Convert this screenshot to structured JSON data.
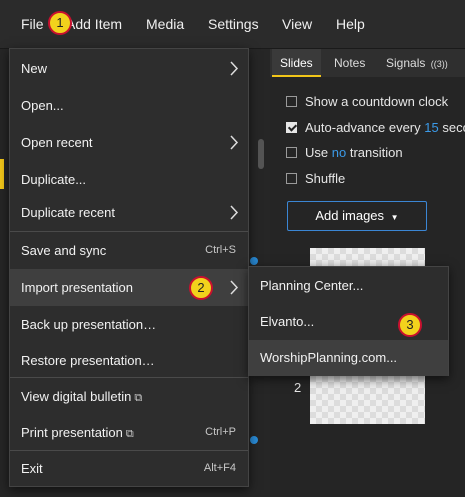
{
  "menubar": {
    "file": "File",
    "add_item": "Add Item",
    "media": "Media",
    "settings": "Settings",
    "view": "View",
    "help": "Help"
  },
  "callouts": [
    "1",
    "2",
    "3"
  ],
  "file_menu": {
    "new": "New",
    "open": "Open...",
    "open_recent": "Open recent",
    "duplicate": "Duplicate...",
    "duplicate_recent": "Duplicate recent",
    "save_and_sync": "Save and sync",
    "save_shortcut": "Ctrl+S",
    "import_presentation": "Import presentation",
    "back_up": "Back up presentation…",
    "restore": "Restore presentation…",
    "view_bulletin": "View digital bulletin",
    "print": "Print presentation",
    "print_shortcut": "Ctrl+P",
    "exit": "Exit",
    "exit_shortcut": "Alt+F4"
  },
  "import_submenu": {
    "planning_center": "Planning Center...",
    "elvanto": "Elvanto...",
    "worship_planning": "WorshipPlanning.com..."
  },
  "right_panel": {
    "tabs": {
      "slides": "Slides",
      "notes": "Notes",
      "signals": "Signals",
      "signals_icon": "((3))"
    },
    "options": {
      "countdown": "Show a countdown clock",
      "auto_advance_prefix": "Auto-advance every",
      "auto_advance_value": "15",
      "auto_advance_suffix": "seco",
      "use_prefix": "Use",
      "use_value": "no",
      "use_suffix": "transition",
      "shuffle": "Shuffle"
    },
    "checked": {
      "countdown": false,
      "auto_advance": true,
      "use_transition": false,
      "shuffle": false
    },
    "add_images": "Add images",
    "slide_numbers": [
      "2"
    ]
  },
  "colors": {
    "accent_blue": "#3b9ae8",
    "callout_fill": "#f2d21c",
    "callout_border": "#c8102e",
    "tab_underline": "#f2c619"
  }
}
